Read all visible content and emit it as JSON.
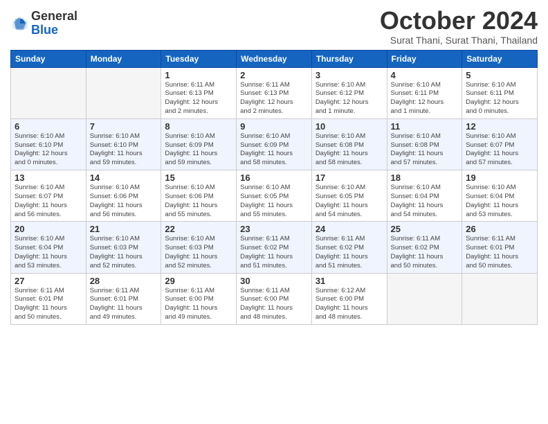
{
  "header": {
    "logo_general": "General",
    "logo_blue": "Blue",
    "month_title": "October 2024",
    "subtitle": "Surat Thani, Surat Thani, Thailand"
  },
  "days_of_week": [
    "Sunday",
    "Monday",
    "Tuesday",
    "Wednesday",
    "Thursday",
    "Friday",
    "Saturday"
  ],
  "weeks": [
    [
      {
        "day": "",
        "info": ""
      },
      {
        "day": "",
        "info": ""
      },
      {
        "day": "1",
        "info": "Sunrise: 6:11 AM\nSunset: 6:13 PM\nDaylight: 12 hours\nand 2 minutes."
      },
      {
        "day": "2",
        "info": "Sunrise: 6:11 AM\nSunset: 6:13 PM\nDaylight: 12 hours\nand 2 minutes."
      },
      {
        "day": "3",
        "info": "Sunrise: 6:10 AM\nSunset: 6:12 PM\nDaylight: 12 hours\nand 1 minute."
      },
      {
        "day": "4",
        "info": "Sunrise: 6:10 AM\nSunset: 6:11 PM\nDaylight: 12 hours\nand 1 minute."
      },
      {
        "day": "5",
        "info": "Sunrise: 6:10 AM\nSunset: 6:11 PM\nDaylight: 12 hours\nand 0 minutes."
      }
    ],
    [
      {
        "day": "6",
        "info": "Sunrise: 6:10 AM\nSunset: 6:10 PM\nDaylight: 12 hours\nand 0 minutes."
      },
      {
        "day": "7",
        "info": "Sunrise: 6:10 AM\nSunset: 6:10 PM\nDaylight: 11 hours\nand 59 minutes."
      },
      {
        "day": "8",
        "info": "Sunrise: 6:10 AM\nSunset: 6:09 PM\nDaylight: 11 hours\nand 59 minutes."
      },
      {
        "day": "9",
        "info": "Sunrise: 6:10 AM\nSunset: 6:09 PM\nDaylight: 11 hours\nand 58 minutes."
      },
      {
        "day": "10",
        "info": "Sunrise: 6:10 AM\nSunset: 6:08 PM\nDaylight: 11 hours\nand 58 minutes."
      },
      {
        "day": "11",
        "info": "Sunrise: 6:10 AM\nSunset: 6:08 PM\nDaylight: 11 hours\nand 57 minutes."
      },
      {
        "day": "12",
        "info": "Sunrise: 6:10 AM\nSunset: 6:07 PM\nDaylight: 11 hours\nand 57 minutes."
      }
    ],
    [
      {
        "day": "13",
        "info": "Sunrise: 6:10 AM\nSunset: 6:07 PM\nDaylight: 11 hours\nand 56 minutes."
      },
      {
        "day": "14",
        "info": "Sunrise: 6:10 AM\nSunset: 6:06 PM\nDaylight: 11 hours\nand 56 minutes."
      },
      {
        "day": "15",
        "info": "Sunrise: 6:10 AM\nSunset: 6:06 PM\nDaylight: 11 hours\nand 55 minutes."
      },
      {
        "day": "16",
        "info": "Sunrise: 6:10 AM\nSunset: 6:05 PM\nDaylight: 11 hours\nand 55 minutes."
      },
      {
        "day": "17",
        "info": "Sunrise: 6:10 AM\nSunset: 6:05 PM\nDaylight: 11 hours\nand 54 minutes."
      },
      {
        "day": "18",
        "info": "Sunrise: 6:10 AM\nSunset: 6:04 PM\nDaylight: 11 hours\nand 54 minutes."
      },
      {
        "day": "19",
        "info": "Sunrise: 6:10 AM\nSunset: 6:04 PM\nDaylight: 11 hours\nand 53 minutes."
      }
    ],
    [
      {
        "day": "20",
        "info": "Sunrise: 6:10 AM\nSunset: 6:04 PM\nDaylight: 11 hours\nand 53 minutes."
      },
      {
        "day": "21",
        "info": "Sunrise: 6:10 AM\nSunset: 6:03 PM\nDaylight: 11 hours\nand 52 minutes."
      },
      {
        "day": "22",
        "info": "Sunrise: 6:10 AM\nSunset: 6:03 PM\nDaylight: 11 hours\nand 52 minutes."
      },
      {
        "day": "23",
        "info": "Sunrise: 6:11 AM\nSunset: 6:02 PM\nDaylight: 11 hours\nand 51 minutes."
      },
      {
        "day": "24",
        "info": "Sunrise: 6:11 AM\nSunset: 6:02 PM\nDaylight: 11 hours\nand 51 minutes."
      },
      {
        "day": "25",
        "info": "Sunrise: 6:11 AM\nSunset: 6:02 PM\nDaylight: 11 hours\nand 50 minutes."
      },
      {
        "day": "26",
        "info": "Sunrise: 6:11 AM\nSunset: 6:01 PM\nDaylight: 11 hours\nand 50 minutes."
      }
    ],
    [
      {
        "day": "27",
        "info": "Sunrise: 6:11 AM\nSunset: 6:01 PM\nDaylight: 11 hours\nand 50 minutes."
      },
      {
        "day": "28",
        "info": "Sunrise: 6:11 AM\nSunset: 6:01 PM\nDaylight: 11 hours\nand 49 minutes."
      },
      {
        "day": "29",
        "info": "Sunrise: 6:11 AM\nSunset: 6:00 PM\nDaylight: 11 hours\nand 49 minutes."
      },
      {
        "day": "30",
        "info": "Sunrise: 6:11 AM\nSunset: 6:00 PM\nDaylight: 11 hours\nand 48 minutes."
      },
      {
        "day": "31",
        "info": "Sunrise: 6:12 AM\nSunset: 6:00 PM\nDaylight: 11 hours\nand 48 minutes."
      },
      {
        "day": "",
        "info": ""
      },
      {
        "day": "",
        "info": ""
      }
    ]
  ]
}
